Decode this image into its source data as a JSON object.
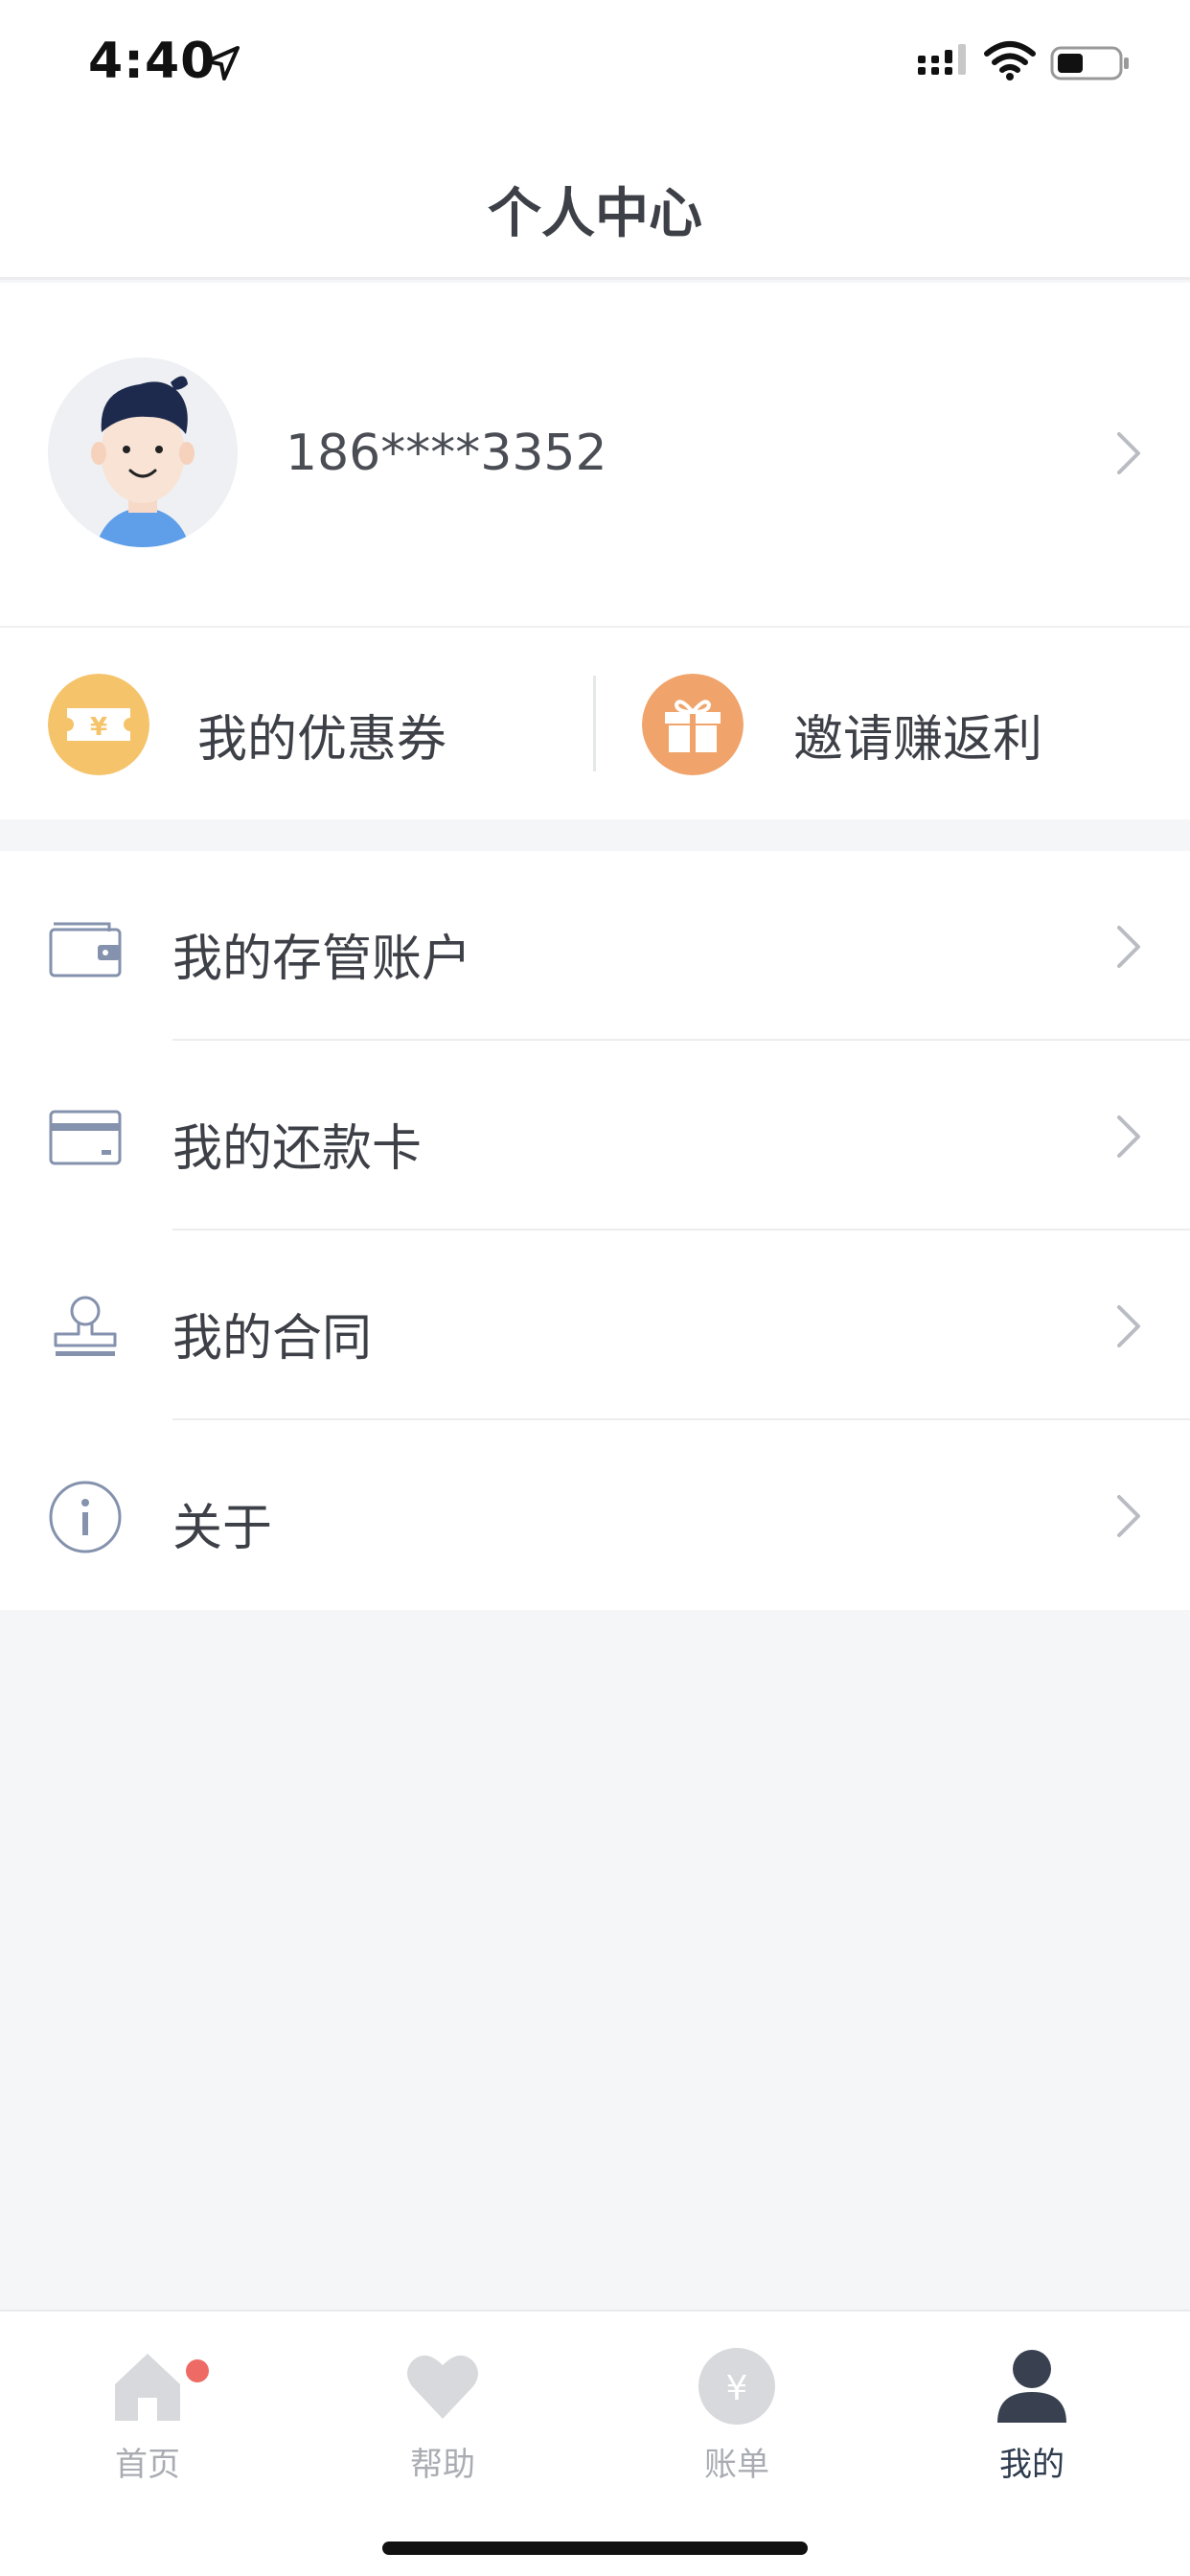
{
  "status_bar": {
    "time": "4:40"
  },
  "header": {
    "title": "个人中心"
  },
  "profile": {
    "phone": "186****3352"
  },
  "quick_actions": [
    {
      "label": "我的优惠券",
      "icon": "coupon-icon",
      "color": "#f5c36a"
    },
    {
      "label": "邀请赚返利",
      "icon": "gift-icon",
      "color": "#f0a46b"
    }
  ],
  "menu": [
    {
      "label": "我的存管账户",
      "icon": "wallet-icon"
    },
    {
      "label": "我的还款卡",
      "icon": "bank-card-icon"
    },
    {
      "label": "我的合同",
      "icon": "stamp-icon"
    },
    {
      "label": "关于",
      "icon": "info-icon"
    }
  ],
  "tab_bar": [
    {
      "label": "首页",
      "icon": "home-icon",
      "has_badge": true,
      "active": false
    },
    {
      "label": "帮助",
      "icon": "heart-icon",
      "has_badge": false,
      "active": false
    },
    {
      "label": "账单",
      "icon": "yuan-icon",
      "has_badge": false,
      "active": false
    },
    {
      "label": "我的",
      "icon": "person-icon",
      "has_badge": false,
      "active": true
    }
  ],
  "colors": {
    "page_bg": "#f5f6f8",
    "text": "#3d4047",
    "tab_inactive": "#a9acb2",
    "tab_active": "#2e3a4d",
    "badge": "#ee6b65",
    "icon_outline": "#8592ad"
  }
}
